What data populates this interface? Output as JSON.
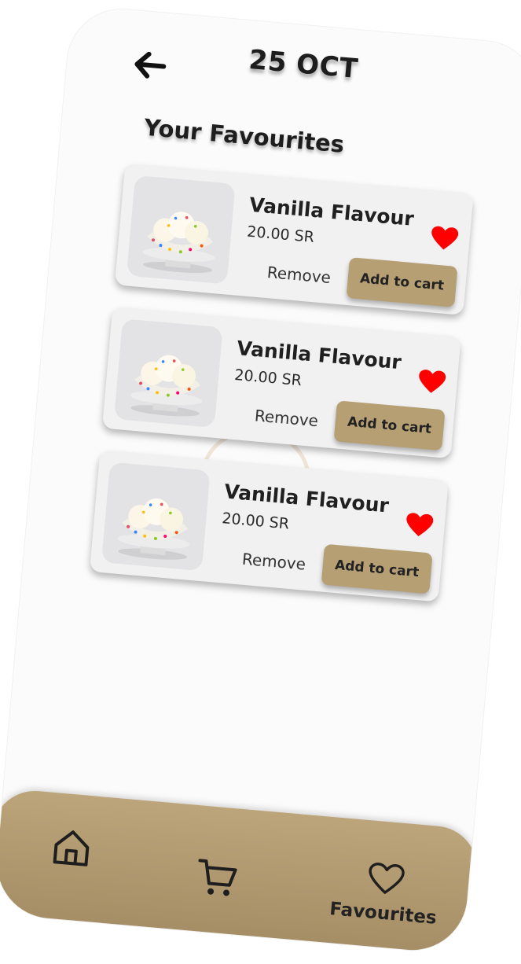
{
  "header": {
    "date": "25 OCT"
  },
  "section_title": "Your Favourites",
  "items": [
    {
      "name": "Vanilla Flavour",
      "price": "20.00 SR",
      "remove_label": "Remove",
      "add_label": "Add to cart",
      "favourite": true
    },
    {
      "name": "Vanilla Flavour",
      "price": "20.00 SR",
      "remove_label": "Remove",
      "add_label": "Add to cart",
      "favourite": true
    },
    {
      "name": "Vanilla Flavour",
      "price": "20.00 SR",
      "remove_label": "Remove",
      "add_label": "Add to cart",
      "favourite": true
    }
  ],
  "nav": {
    "items": [
      {
        "icon": "home-icon",
        "label": ""
      },
      {
        "icon": "cart-icon",
        "label": ""
      },
      {
        "icon": "heart-outline-icon",
        "label": "Favourites"
      }
    ]
  },
  "colors": {
    "accent": "#b79f74",
    "heart": "#ff0000",
    "background": "#fbfbfb",
    "card": "#f1f1f1"
  }
}
